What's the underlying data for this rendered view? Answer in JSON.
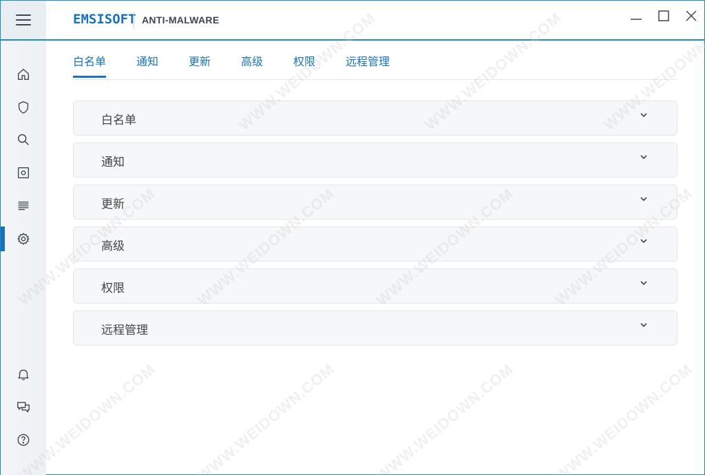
{
  "app": {
    "brand": "EMSISOFT",
    "product": "ANTI-MALWARE"
  },
  "window_controls": {
    "minimize_icon": "minimize-icon",
    "maximize_icon": "maximize-icon",
    "close_icon": "close-icon"
  },
  "sidebar": {
    "items": [
      {
        "id": "home",
        "icon": "home-icon"
      },
      {
        "id": "protection",
        "icon": "shield-icon"
      },
      {
        "id": "scan",
        "icon": "search-icon"
      },
      {
        "id": "quarantine",
        "icon": "quarantine-icon"
      },
      {
        "id": "logs",
        "icon": "logs-icon"
      },
      {
        "id": "settings",
        "icon": "gear-icon",
        "active": true
      },
      {
        "id": "notifications",
        "icon": "bell-icon"
      },
      {
        "id": "support",
        "icon": "chat-icon"
      },
      {
        "id": "help",
        "icon": "help-icon"
      }
    ]
  },
  "tabs": [
    {
      "label": "白名单",
      "active": true
    },
    {
      "label": "通知"
    },
    {
      "label": "更新"
    },
    {
      "label": "高级"
    },
    {
      "label": "权限"
    },
    {
      "label": "远程管理"
    }
  ],
  "sections": [
    {
      "title": "白名单"
    },
    {
      "title": "通知"
    },
    {
      "title": "更新"
    },
    {
      "title": "高级"
    },
    {
      "title": "权限"
    },
    {
      "title": "远程管理"
    }
  ],
  "watermark": "WWW.WEIDOWN.COM",
  "colors": {
    "accent": "#1a73b8",
    "sidebar_bg": "#eef1f4",
    "panel_bg": "#f6f7f8"
  }
}
